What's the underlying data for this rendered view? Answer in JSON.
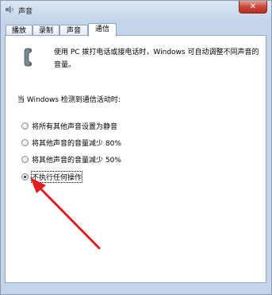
{
  "window": {
    "title": "声音",
    "close_glyph": "✕"
  },
  "tabs": [
    {
      "label": "播放"
    },
    {
      "label": "录制"
    },
    {
      "label": "声音"
    },
    {
      "label": "通信"
    }
  ],
  "active_tab": "通信",
  "communications": {
    "description": "使用 PC 拨打电话或接电话时，Windows 可自动调整不同声音的音量。",
    "detect_label": "当 Windows 检测到通信活动时:",
    "options": [
      {
        "label": "将所有其他声音设置为静音",
        "checked": false
      },
      {
        "label": "将其他声音的音量减少 80%",
        "checked": false
      },
      {
        "label": "将其他声音的音量减少 50%",
        "checked": false
      },
      {
        "label": "不执行任何操作",
        "checked": true
      }
    ]
  },
  "annotation": {
    "arrow_color": "#e02020"
  }
}
